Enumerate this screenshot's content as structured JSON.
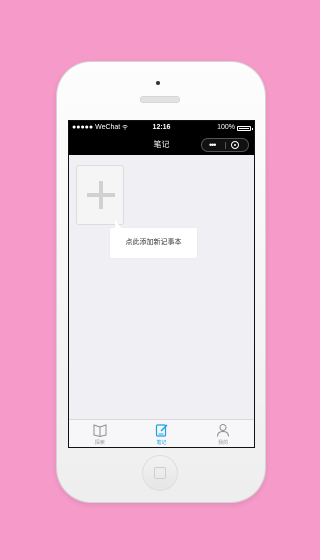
{
  "status_bar": {
    "carrier": "●●●●● WeChat",
    "wifi_icon": "wifi-icon",
    "time": "12:16",
    "battery": "100%"
  },
  "nav": {
    "title": "笔记",
    "more_icon": "•••"
  },
  "content": {
    "add_button_icon": "plus-icon",
    "tooltip": "点此添加新记事本"
  },
  "tabs": [
    {
      "label": "探索",
      "icon": "book-icon",
      "active": false
    },
    {
      "label": "笔记",
      "icon": "edit-note-icon",
      "active": true
    },
    {
      "label": "我的",
      "icon": "person-icon",
      "active": false
    }
  ],
  "colors": {
    "background": "#f59ac9",
    "accent": "#1aa3e9"
  }
}
